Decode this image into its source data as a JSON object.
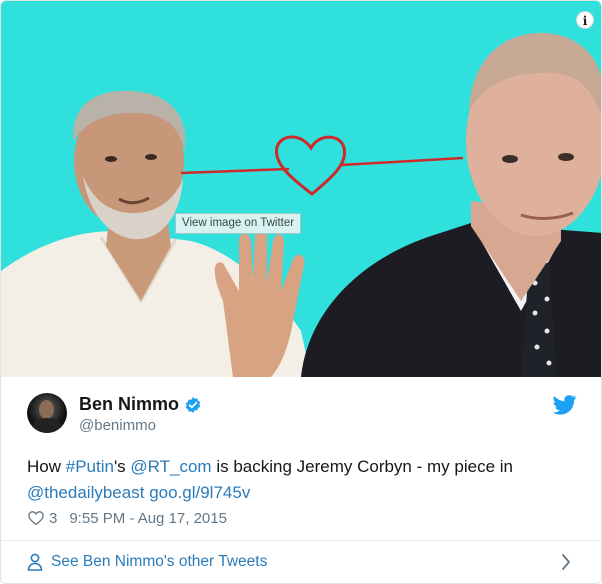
{
  "media": {
    "tooltip": "View image on Twitter",
    "info_glyph": "i",
    "background_color": "#2fe0dc",
    "heart_color": "#cf2a2a"
  },
  "author": {
    "name": "Ben Nimmo",
    "handle": "@benimmo",
    "verified": true
  },
  "tweet": {
    "text_1": "How ",
    "hashtag": "#Putin",
    "text_2": "'s ",
    "mention": "@RT_com",
    "text_3": " is backing Jeremy Corbyn - my piece in",
    "mention_2": "@thedailybeast",
    "text_4": " ",
    "short_link": "goo.gl/9l745v"
  },
  "meta": {
    "likes": "3",
    "timestamp": "9:55 PM - Aug 17, 2015"
  },
  "footer": {
    "label": "See Ben Nimmo's other Tweets"
  },
  "colors": {
    "link": "#2b7bb9",
    "muted": "#657786",
    "twitter_blue": "#1da1f2"
  },
  "icons": [
    "info-icon",
    "verified-badge-icon",
    "twitter-bird-icon",
    "heart-icon",
    "person-icon",
    "chevron-right-icon"
  ]
}
